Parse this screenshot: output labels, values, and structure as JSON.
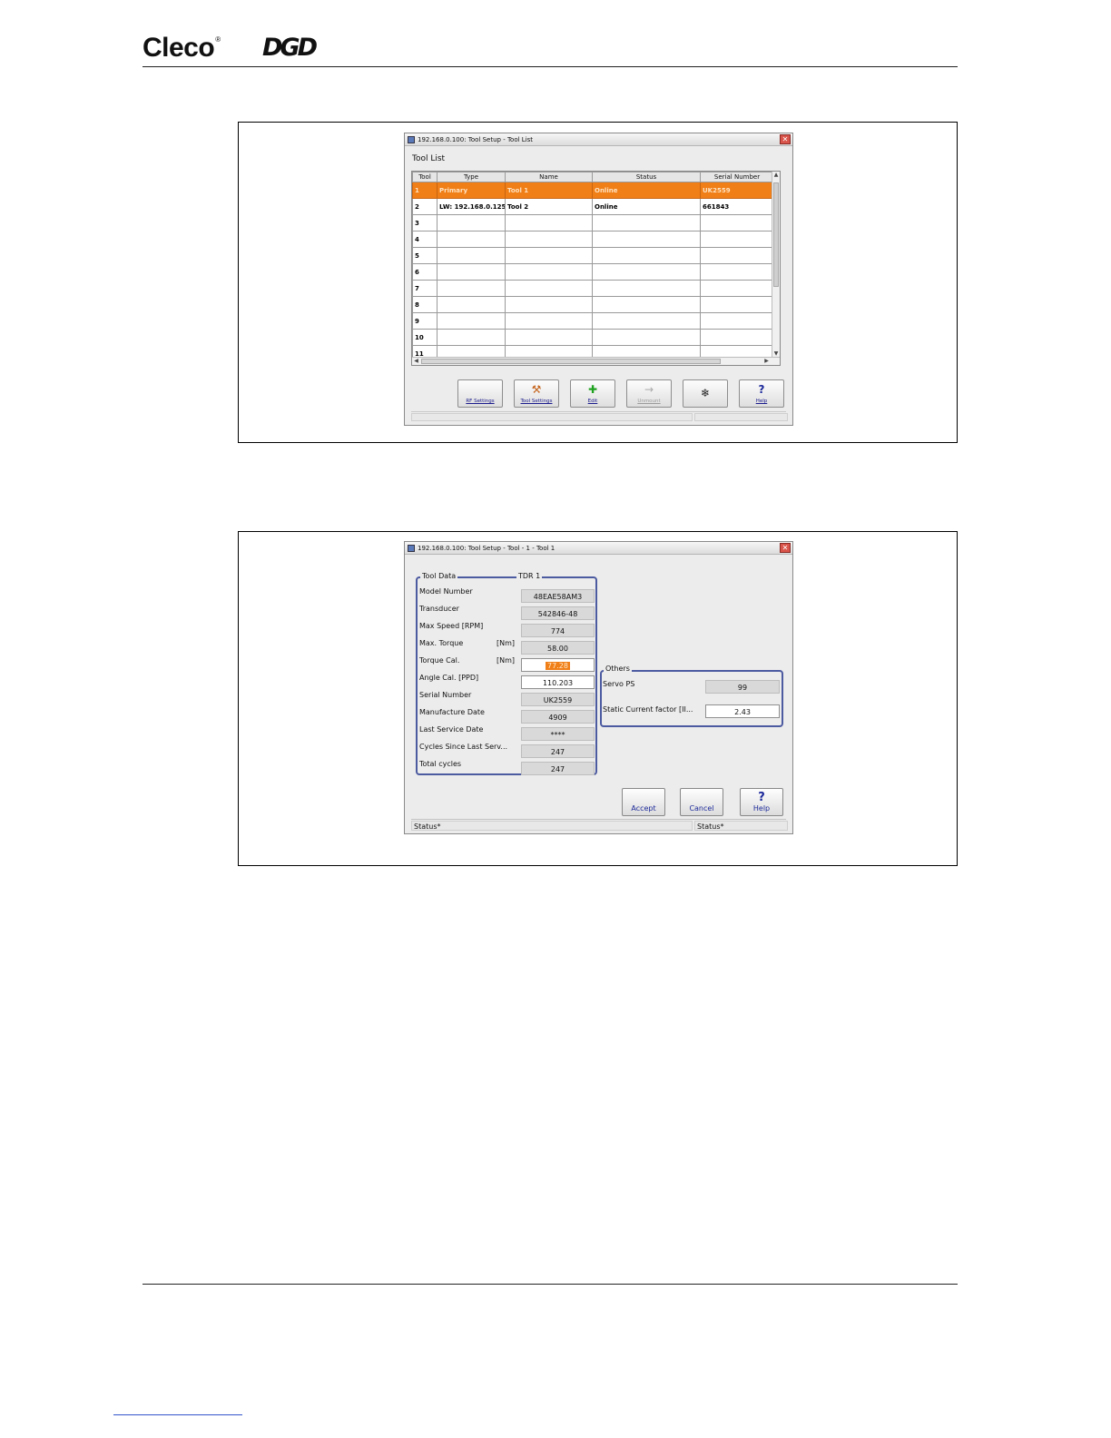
{
  "header": {
    "brand_cleco": "Cleco",
    "brand_reg": "®",
    "brand_dgd": "DGD"
  },
  "tool_list_window": {
    "title": "192.168.0.100: Tool Setup - Tool List",
    "heading": "Tool List",
    "columns": [
      "Tool",
      "Type",
      "Name",
      "Status",
      "Serial Number"
    ],
    "rows": [
      {
        "tool": "1",
        "type": "Primary",
        "name": "Tool 1",
        "status": "Online",
        "serial": "UK2559",
        "selected": true
      },
      {
        "tool": "2",
        "type": "LW: 192.168.0.125",
        "name": "Tool 2",
        "status": "Online",
        "serial": "661843",
        "selected": false
      },
      {
        "tool": "3",
        "type": "",
        "name": "",
        "status": "",
        "serial": "",
        "selected": false
      },
      {
        "tool": "4",
        "type": "",
        "name": "",
        "status": "",
        "serial": "",
        "selected": false
      },
      {
        "tool": "5",
        "type": "",
        "name": "",
        "status": "",
        "serial": "",
        "selected": false
      },
      {
        "tool": "6",
        "type": "",
        "name": "",
        "status": "",
        "serial": "",
        "selected": false
      },
      {
        "tool": "7",
        "type": "",
        "name": "",
        "status": "",
        "serial": "",
        "selected": false
      },
      {
        "tool": "8",
        "type": "",
        "name": "",
        "status": "",
        "serial": "",
        "selected": false
      },
      {
        "tool": "9",
        "type": "",
        "name": "",
        "status": "",
        "serial": "",
        "selected": false
      },
      {
        "tool": "10",
        "type": "",
        "name": "",
        "status": "",
        "serial": "",
        "selected": false
      },
      {
        "tool": "11",
        "type": "",
        "name": "",
        "status": "",
        "serial": "",
        "selected": false
      }
    ],
    "buttons": {
      "rf_settings": "RF Settings",
      "tool_settings": "Tool Settings",
      "edit": "Edit",
      "unmount": "Unmount",
      "snowflake": "",
      "help": "Help"
    },
    "button_icons": {
      "rf_settings": "blank-icon",
      "tool_settings": "wrench-tool-icon",
      "edit": "plus-icon",
      "unmount": "arrow-right-icon",
      "snowflake": "snowflake-icon",
      "help": "question-mark-icon"
    }
  },
  "tool_data_window": {
    "title": "192.168.0.100: Tool Setup - Tool - 1 - Tool 1",
    "group_tool_data": "Tool Data",
    "tool_id": "TDR 1",
    "fields": [
      {
        "label": "Model Number",
        "unit": "",
        "value": "48EAE58AM3",
        "editable": false
      },
      {
        "label": "Transducer",
        "unit": "",
        "value": "542846-48",
        "editable": false
      },
      {
        "label": "Max Speed [RPM]",
        "unit": "",
        "value": "774",
        "editable": false
      },
      {
        "label": "Max. Torque",
        "unit": "[Nm]",
        "value": "58.00",
        "editable": false
      },
      {
        "label": "Torque Cal.",
        "unit": "[Nm]",
        "value": "77.28",
        "editable": true
      },
      {
        "label": "Angle Cal. [PPD]",
        "unit": "",
        "value": "110.203",
        "editable": true
      },
      {
        "label": "Serial Number",
        "unit": "",
        "value": "UK2559",
        "editable": false
      },
      {
        "label": "Manufacture Date",
        "unit": "",
        "value": "4909",
        "editable": false
      },
      {
        "label": "Last Service Date",
        "unit": "",
        "value": "****",
        "editable": false
      },
      {
        "label": "Cycles Since Last Serv...",
        "unit": "",
        "value": "247",
        "editable": false
      },
      {
        "label": "Total cycles",
        "unit": "",
        "value": "247",
        "editable": false
      }
    ],
    "group_others": "Others",
    "others": [
      {
        "label": "Servo PS",
        "value": "99",
        "editable": false
      },
      {
        "label": "Static Current factor [II...",
        "value": "2.43",
        "editable": true
      }
    ],
    "buttons": {
      "accept": "Accept",
      "cancel": "Cancel",
      "help": "Help"
    },
    "status_left": "Status*",
    "status_right": "Status*"
  }
}
